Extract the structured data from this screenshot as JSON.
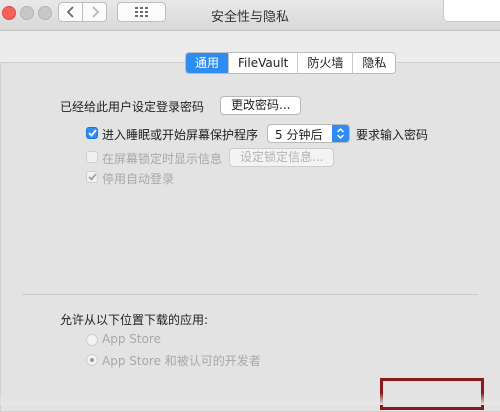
{
  "window": {
    "title": "安全性与隐私",
    "icons": {
      "close": "close-light",
      "back": "chevron-left-icon",
      "forward": "chevron-right-icon",
      "grid": "grid-icon"
    },
    "accent_color": "#2d8df4",
    "highlight_color": "#8b1a1a"
  },
  "tabs": [
    {
      "label": "通用",
      "active": true
    },
    {
      "label": "FileVault",
      "active": false
    },
    {
      "label": "防火墙",
      "active": false
    },
    {
      "label": "隐私",
      "active": false
    }
  ],
  "general": {
    "password_set_label": "已经给此用户设定登录密码",
    "change_password_button": "更改密码...",
    "require_password": {
      "checked": true,
      "label_before": "进入睡眠或开始屏幕保护程序",
      "delay_value": "5 分钟后",
      "label_after": "要求输入密码"
    },
    "show_message": {
      "checked": false,
      "enabled": false,
      "label": "在屏幕锁定时显示信息",
      "button": "设定锁定信息..."
    },
    "disable_auto_login": {
      "checked": true,
      "enabled": false,
      "label": "停用自动登录"
    }
  },
  "downloads": {
    "heading": "允许从以下位置下载的应用:",
    "options": [
      {
        "label": "App Store",
        "selected": false
      },
      {
        "label": "App Store 和被认可的开发者",
        "selected": true
      }
    ]
  }
}
